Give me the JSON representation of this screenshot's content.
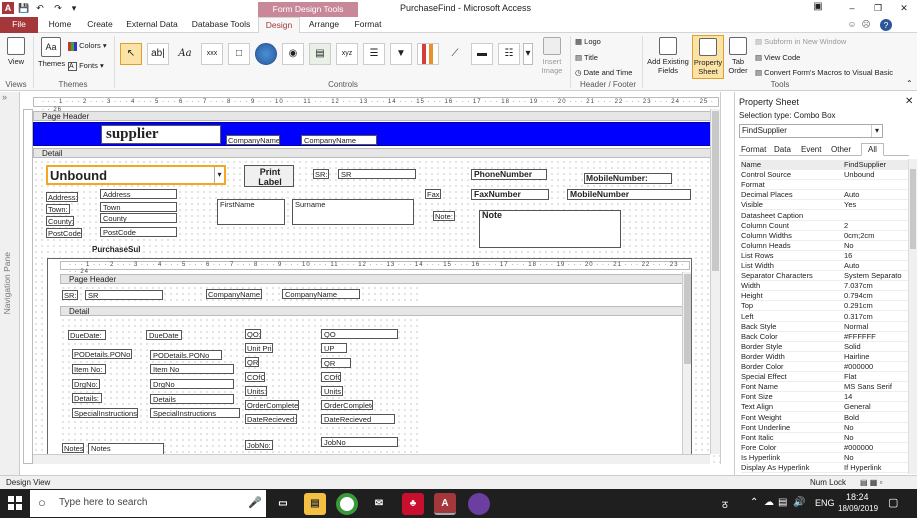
{
  "window": {
    "title": "PurchaseFind  -  Microsoft Access",
    "context_tab": "Form Design Tools",
    "quick_access": [
      "A",
      "save",
      "undo",
      "redo"
    ],
    "controls": [
      "?",
      "–",
      "❐",
      "✕"
    ],
    "user_icons": [
      "☺",
      "☹",
      "?"
    ]
  },
  "tabs": [
    {
      "label": "File"
    },
    {
      "label": "Home"
    },
    {
      "label": "Create"
    },
    {
      "label": "External Data"
    },
    {
      "label": "Database Tools"
    },
    {
      "label": "Design"
    },
    {
      "label": "Arrange"
    },
    {
      "label": "Format"
    }
  ],
  "ribbon": {
    "views": {
      "button": "View",
      "group": "Views"
    },
    "themes": {
      "themes": "Themes",
      "colors": "Colors",
      "fonts": "Fonts",
      "group": "Themes"
    },
    "controls": {
      "group": "Controls",
      "insert_image": "Insert Image",
      "aa": "Aa"
    },
    "header_footer": {
      "logo": "Logo",
      "title": "Title",
      "date_time": "Date and Time",
      "group": "Header / Footer"
    },
    "tools": {
      "add_fields": "Add Existing Fields",
      "property_sheet": "Property Sheet",
      "tab_order": "Tab Order",
      "subform": "Subform in New Window",
      "view_code": "View Code",
      "convert_macros": "Convert Form's Macros to Visual Basic",
      "group": "Tools"
    }
  },
  "nav_pane": {
    "label": "Navigation Pane"
  },
  "form": {
    "page_header": "Page Header",
    "detail": "Detail",
    "supplier_title": "supplier",
    "company_name_label": "CompanyName:",
    "company_name_field": "CompanyName",
    "unbound": "Unbound",
    "print_label": "Print Label",
    "sr_label": "SR:",
    "sr_field": "SR",
    "phone": "PhoneNumber",
    "mobile": "MobileNumber:",
    "fax_label": "Fax:",
    "fax": "FaxNumber",
    "mobile_field": "MobileNumber",
    "note_label": "Note:",
    "note": "Note",
    "address_label": "Address:",
    "address": "Address",
    "town_label": "Town:",
    "town": "Town",
    "county_label": "County:",
    "county": "County",
    "postcode_label": "PostCode:",
    "postcode": "PostCode",
    "firstname": "FirstName",
    "surname": "Surname",
    "purchase_sub": "PurchaseSul"
  },
  "subform": {
    "page_header": "Page Header",
    "detail": "Detail",
    "sr_label": "SR:",
    "sr": "SR",
    "company_name_label": "CompanyName:",
    "company_name": "CompanyName",
    "left_labels": [
      "DueDate:",
      "PODetails.PONo:",
      "Item No:",
      "DrgNo:",
      "Details:",
      "SpecialInstructions:"
    ],
    "left_fields": [
      "DueDate",
      "PODetails.PONo",
      "Item No",
      "DrgNo",
      "Details",
      "SpecialInstructions"
    ],
    "right_labels": [
      "QO:",
      "Unit Pric",
      "QR:",
      "COfC:",
      "Units:",
      "OrderComplete:",
      "DateRecieved:",
      "JobNo:"
    ],
    "right_fields": [
      "QO",
      "UP",
      "QR",
      "COfC",
      "Units",
      "OrderComplete",
      "DateRecieved",
      "JobNo"
    ],
    "notes_label": "Notes:",
    "notes": "Notes"
  },
  "property_sheet": {
    "title": "Property Sheet",
    "selection_type_label": "Selection type:",
    "selection_type": "Combo Box",
    "selected": "FindSupplier",
    "tabs": [
      "Format",
      "Data",
      "Event",
      "Other",
      "All"
    ],
    "rows": [
      {
        "k": "Name",
        "v": "FindSupplier"
      },
      {
        "k": "Control Source",
        "v": "Unbound"
      },
      {
        "k": "Format",
        "v": ""
      },
      {
        "k": "Decimal Places",
        "v": "Auto"
      },
      {
        "k": "Visible",
        "v": "Yes"
      },
      {
        "k": "Datasheet Caption",
        "v": ""
      },
      {
        "k": "Column Count",
        "v": "2"
      },
      {
        "k": "Column Widths",
        "v": "0cm;2cm"
      },
      {
        "k": "Column Heads",
        "v": "No"
      },
      {
        "k": "List Rows",
        "v": "16"
      },
      {
        "k": "List Width",
        "v": "Auto"
      },
      {
        "k": "Separator Characters",
        "v": "System Separato"
      },
      {
        "k": "Width",
        "v": "7.037cm"
      },
      {
        "k": "Height",
        "v": "0.794cm"
      },
      {
        "k": "Top",
        "v": "0.291cm"
      },
      {
        "k": "Left",
        "v": "0.317cm"
      },
      {
        "k": "Back Style",
        "v": "Normal"
      },
      {
        "k": "Back Color",
        "v": "#FFFFFF"
      },
      {
        "k": "Border Style",
        "v": "Solid"
      },
      {
        "k": "Border Width",
        "v": "Hairline"
      },
      {
        "k": "Border Color",
        "v": "#000000"
      },
      {
        "k": "Special Effect",
        "v": "Flat"
      },
      {
        "k": "Font Name",
        "v": "MS Sans Serif"
      },
      {
        "k": "Font Size",
        "v": "14"
      },
      {
        "k": "Text Align",
        "v": "General"
      },
      {
        "k": "Font Weight",
        "v": "Bold"
      },
      {
        "k": "Font Underline",
        "v": "No"
      },
      {
        "k": "Font Italic",
        "v": "No"
      },
      {
        "k": "Fore Color",
        "v": "#000000"
      },
      {
        "k": "Is Hyperlink",
        "v": "No"
      },
      {
        "k": "Display As Hyperlink",
        "v": "If Hyperlink"
      }
    ]
  },
  "status": {
    "left": "Design View",
    "right": "Num Lock"
  },
  "taskbar": {
    "search": "Type here to search",
    "time": "18:24",
    "date": "18/09/2019",
    "lang": "ENG"
  },
  "colors": {
    "access_red": "#a4373a",
    "header_blue": "#0000ff",
    "selected_orange": "#f5a623",
    "taskbar": "#1f1f1f"
  }
}
